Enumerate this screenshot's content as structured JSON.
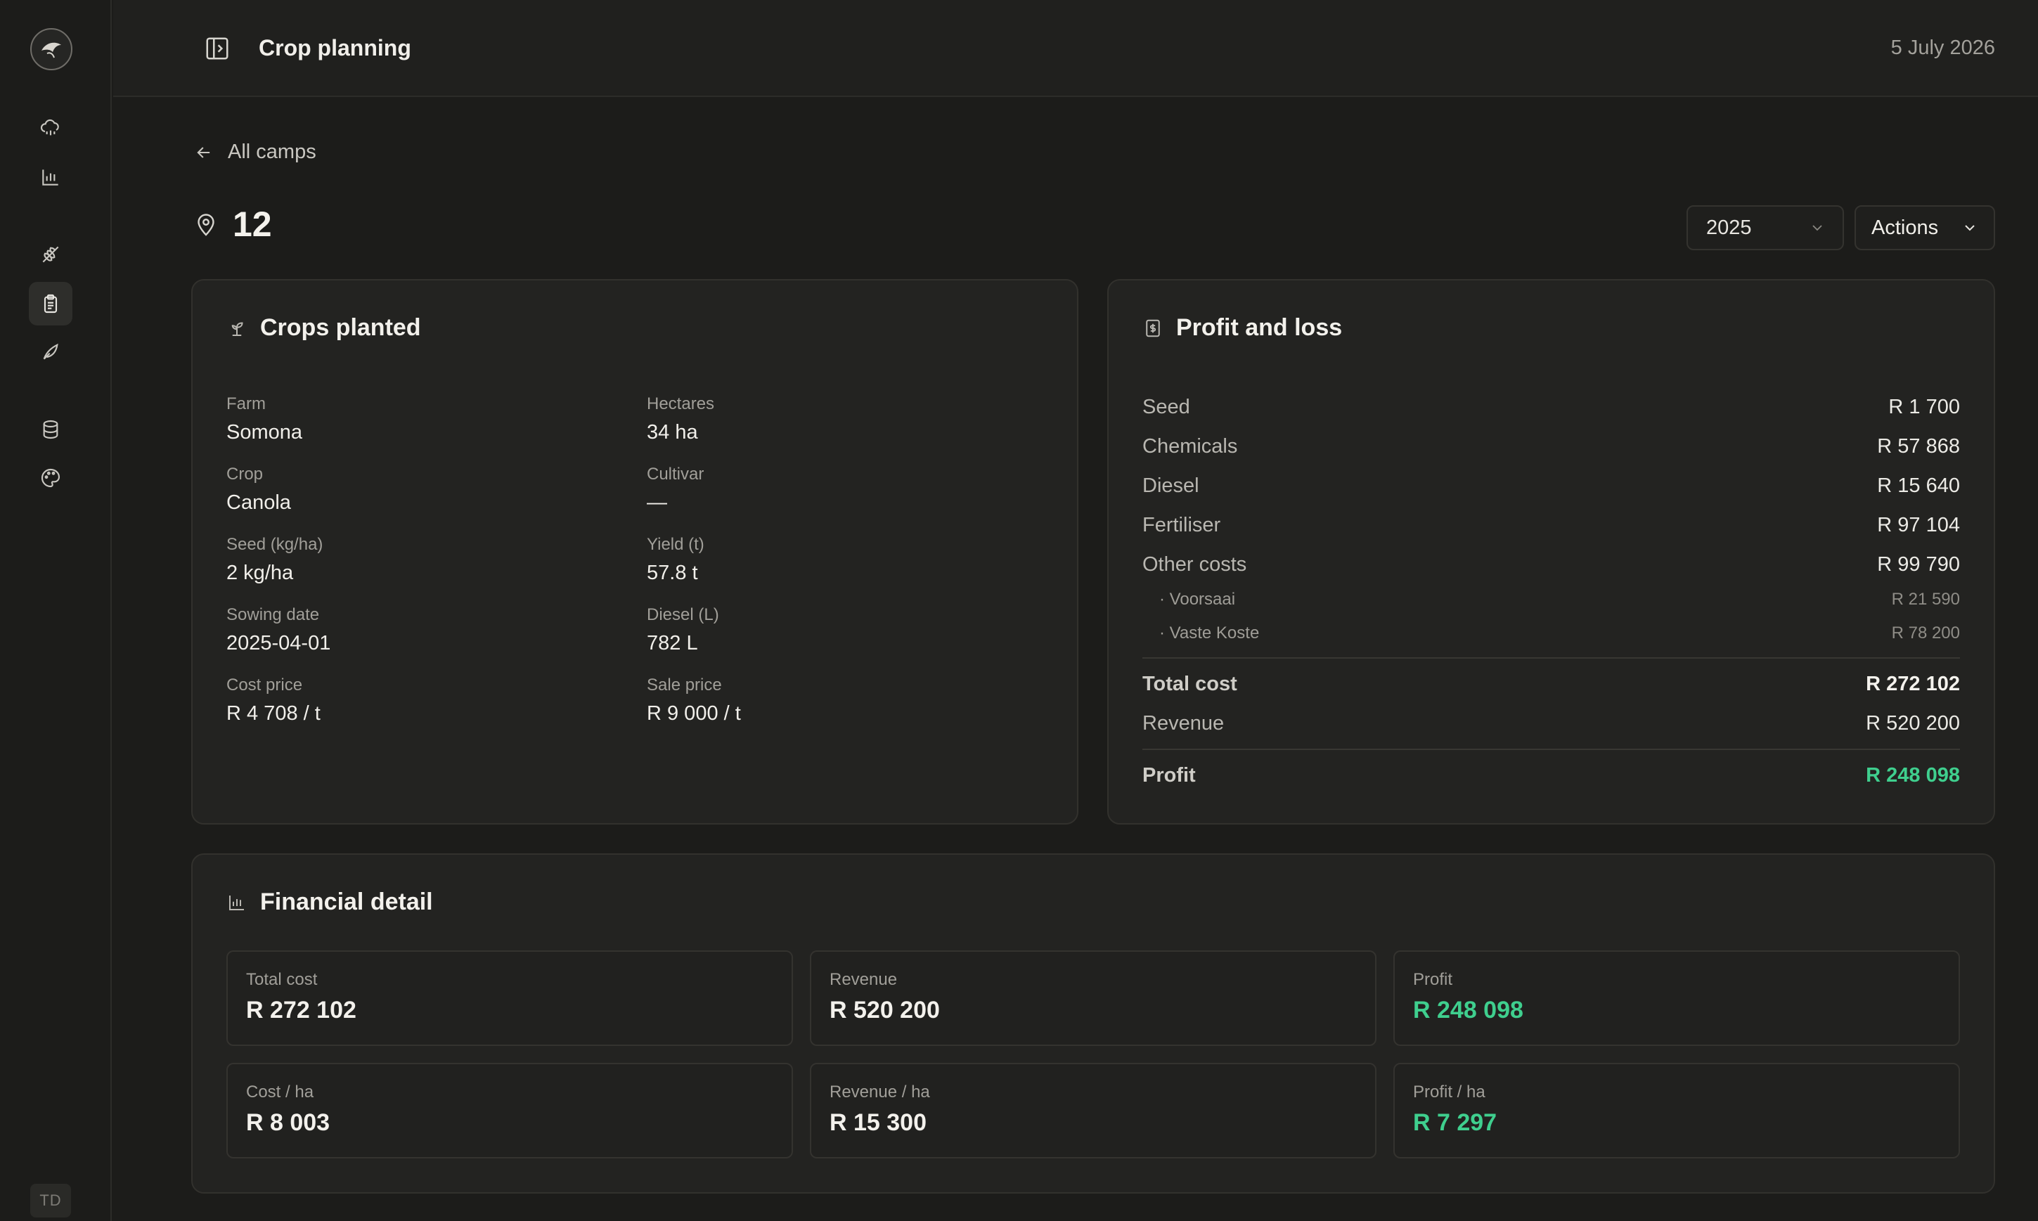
{
  "sidebar": {
    "avatar_initials": "TD",
    "icons": [
      "cloud-rain-icon",
      "bar-chart-icon",
      "wheat-icon",
      "clipboard-icon",
      "sprout-icon",
      "database-icon",
      "palette-icon"
    ]
  },
  "header": {
    "title": "Crop planning",
    "date": "5 July 2026"
  },
  "nav": {
    "back_label": "All camps"
  },
  "camp": {
    "name": "12",
    "year": "2025",
    "actions_label": "Actions"
  },
  "crops_planted": {
    "title": "Crops planted",
    "fields": [
      {
        "label": "Farm",
        "value": "Somona"
      },
      {
        "label": "Hectares",
        "value": "34 ha"
      },
      {
        "label": "Crop",
        "value": "Canola"
      },
      {
        "label": "Cultivar",
        "value": "—"
      },
      {
        "label": "Seed (kg/ha)",
        "value": "2 kg/ha"
      },
      {
        "label": "Yield (t)",
        "value": "57.8 t"
      },
      {
        "label": "Sowing date",
        "value": "2025-04-01"
      },
      {
        "label": "Diesel (L)",
        "value": "782 L"
      },
      {
        "label": "Cost price",
        "value": "R 4 708 / t"
      },
      {
        "label": "Sale price",
        "value": "R 9 000 / t"
      }
    ]
  },
  "profit_loss": {
    "title": "Profit and loss",
    "rows": [
      {
        "label": "Seed",
        "value": "R 1 700"
      },
      {
        "label": "Chemicals",
        "value": "R 57 868"
      },
      {
        "label": "Diesel",
        "value": "R 15 640"
      },
      {
        "label": "Fertiliser",
        "value": "R 97 104"
      },
      {
        "label": "Other costs",
        "value": "R 99 790"
      },
      {
        "label": "· Voorsaai",
        "value": "R 21 590"
      },
      {
        "label": "· Vaste Koste",
        "value": "R 78 200"
      }
    ],
    "total_cost_label": "Total cost",
    "total_cost": "R 272 102",
    "revenue_label": "Revenue",
    "revenue": "R 520 200",
    "profit_label": "Profit",
    "profit": "R 248 098"
  },
  "financial": {
    "title": "Financial detail",
    "metrics": [
      {
        "label": "Total cost",
        "value": "R 272 102"
      },
      {
        "label": "Revenue",
        "value": "R 520 200"
      },
      {
        "label": "Profit",
        "value": "R 248 098"
      },
      {
        "label": "Cost / ha",
        "value": "R 8 003"
      },
      {
        "label": "Revenue / ha",
        "value": "R 15 300"
      },
      {
        "label": "Profit / ha",
        "value": "R 7 297"
      }
    ]
  },
  "colors": {
    "accent_green": "#3fcf8e",
    "background": "#1c1c1a",
    "card": "#232321"
  }
}
